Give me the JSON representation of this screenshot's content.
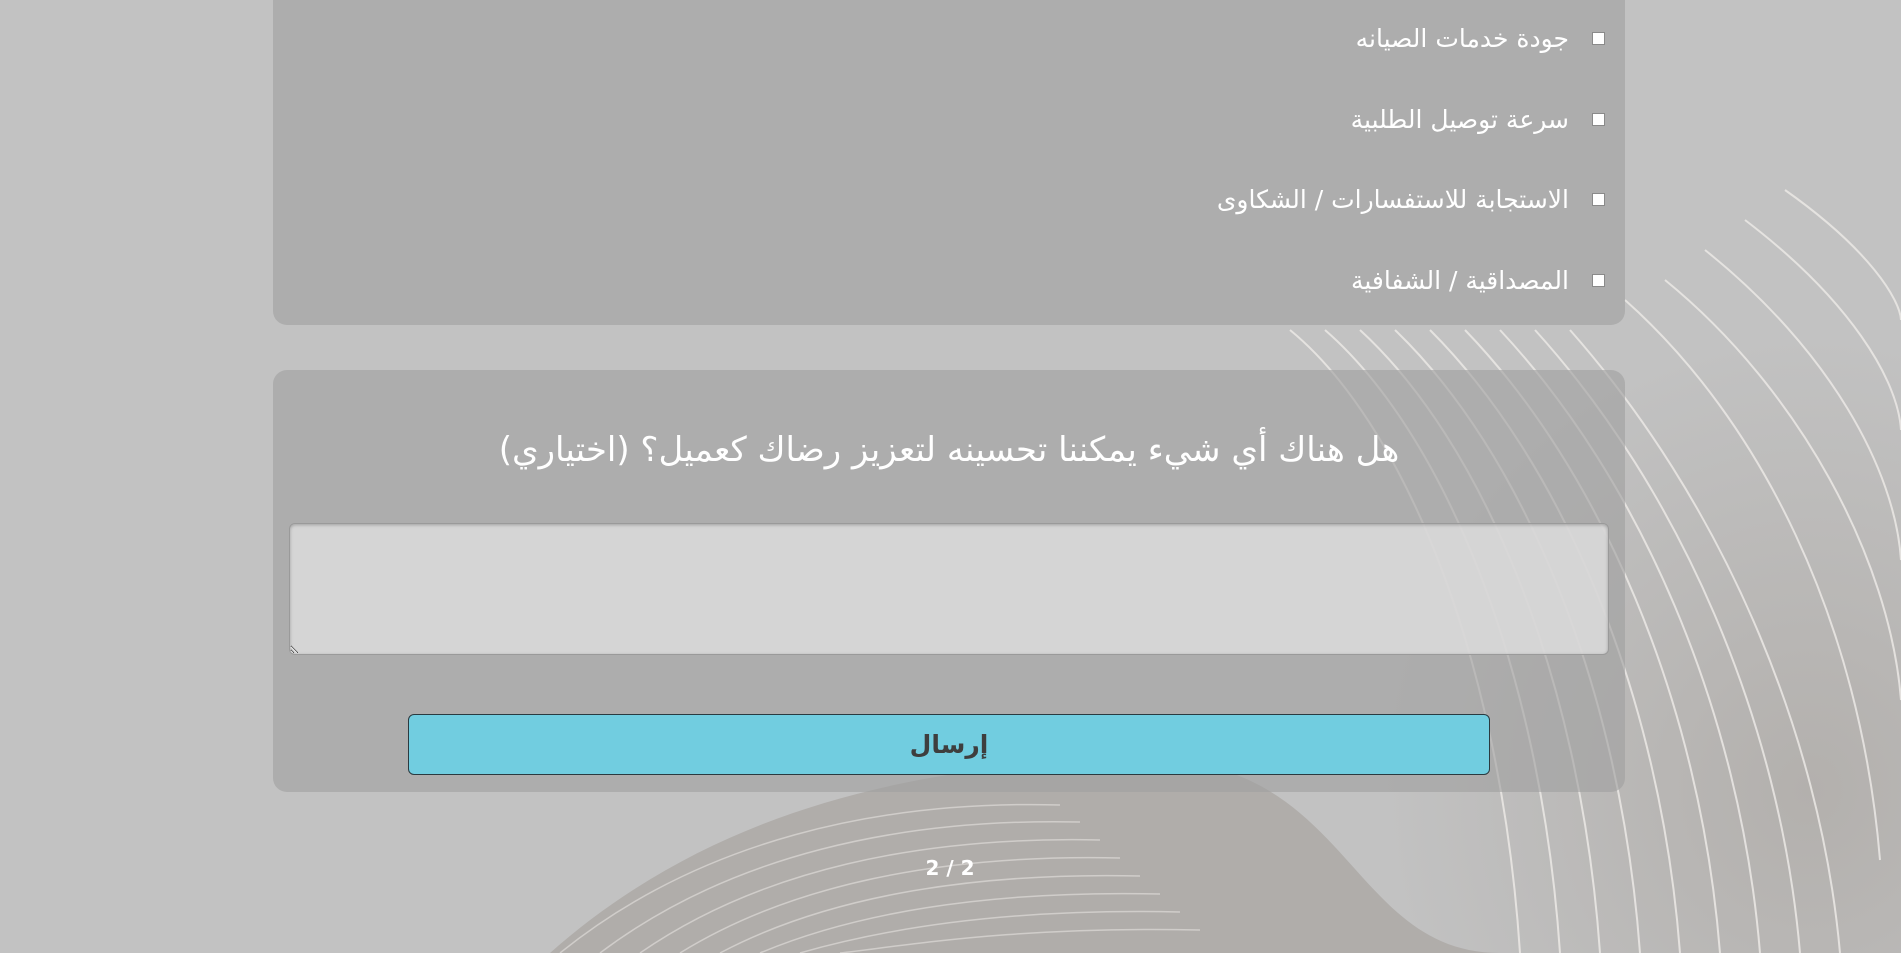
{
  "background": {
    "color": "#c2c2c2",
    "decoration": "curved-lines-art"
  },
  "options": {
    "items": [
      {
        "label": "جودة خدمات الصيانه"
      },
      {
        "label": "سرعة توصيل الطلبية"
      },
      {
        "label": "الاستجابة للاستفسارات / الشكاوى"
      },
      {
        "label": "المصداقية / الشفافية"
      }
    ]
  },
  "question": {
    "text": "هل هناك أي شيء يمكننا تحسينه لتعزيز رضاك كعميل؟ (اختياري)",
    "answer_value": ""
  },
  "submit": {
    "label": "إرسال",
    "color": "#71cde0"
  },
  "pagination": {
    "text": "2 / 2"
  }
}
